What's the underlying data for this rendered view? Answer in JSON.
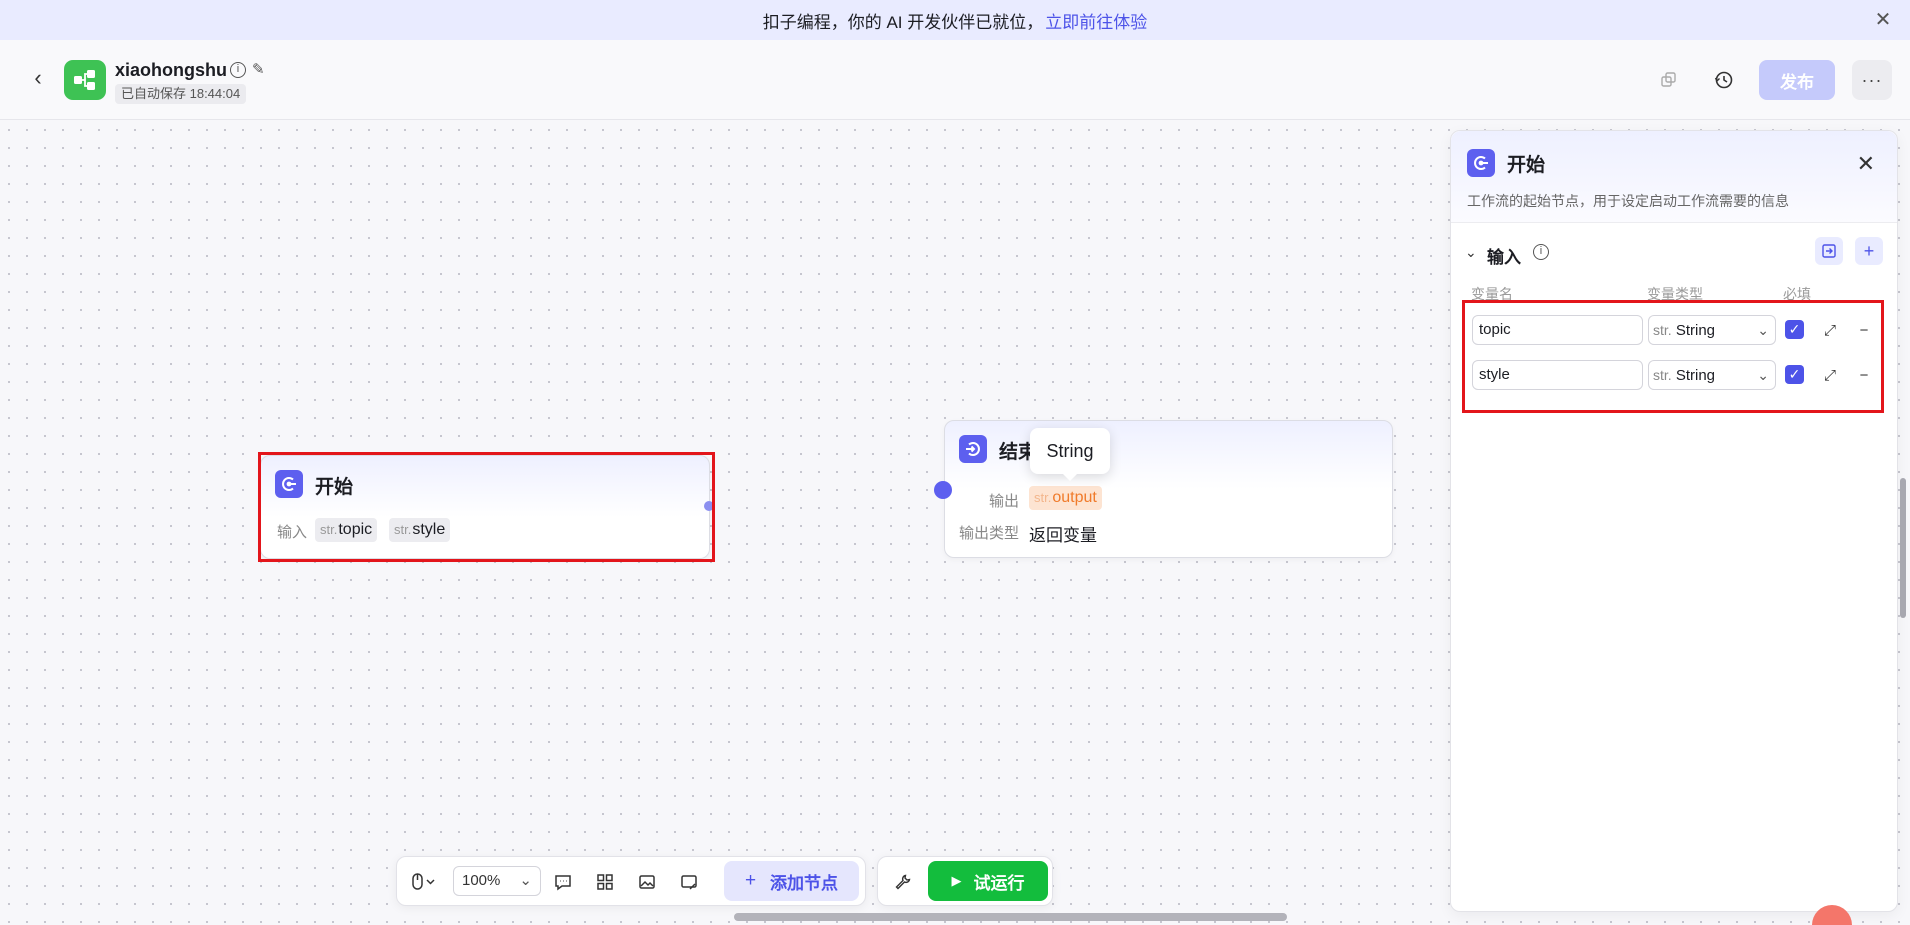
{
  "banner": {
    "text": "扣子编程，你的 AI 开发伙伴已就位，",
    "link": "立即前往体验"
  },
  "header": {
    "app_name": "xiaohongshu",
    "save_status": "已自动保存 18:44:04",
    "publish_label": "发布",
    "more_label": "···"
  },
  "start_node": {
    "title": "开始",
    "input_label": "输入",
    "inputs": [
      {
        "type": "str.",
        "name": "topic"
      },
      {
        "type": "str.",
        "name": "style"
      }
    ]
  },
  "end_node": {
    "title": "结束",
    "output_label": "输出",
    "output_tag": {
      "type": "str.",
      "name": "output"
    },
    "output_type_label": "输出类型",
    "output_type_value": "返回变量",
    "tooltip": "String"
  },
  "panel": {
    "title": "开始",
    "description": "工作流的起始节点，用于设定启动工作流需要的信息",
    "section_title": "输入",
    "columns": {
      "name": "变量名",
      "type": "变量类型",
      "required": "必填"
    },
    "rows": [
      {
        "name": "topic",
        "type_prefix": "str.",
        "type": "String",
        "required": true
      },
      {
        "name": "style",
        "type_prefix": "str.",
        "type": "String",
        "required": true
      }
    ]
  },
  "toolbar": {
    "zoom": "100%",
    "add_node_label": "添加节点",
    "run_label": "试运行"
  },
  "colors": {
    "accent": "#4d53e8",
    "node_icon": "#5d5fef",
    "run_green": "#13bd3d",
    "highlight_red": "#e3151b",
    "app_logo_green": "#3ec254"
  }
}
